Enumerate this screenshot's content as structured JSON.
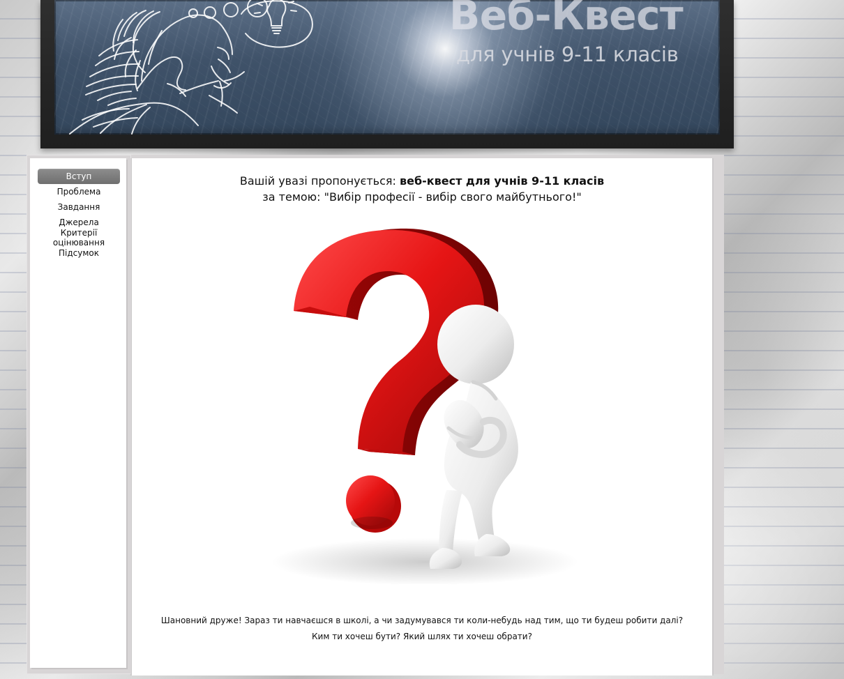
{
  "header": {
    "title": "Веб-Квест",
    "subtitle": "для учнів 9-11 класів"
  },
  "sidebar": {
    "items": [
      {
        "label": "Вступ",
        "active": true
      },
      {
        "label": "Проблема",
        "active": false
      },
      {
        "label": "Завдання",
        "active": false
      },
      {
        "label": "Джерела",
        "active": false
      },
      {
        "label": "Критерії оцінювання",
        "active": false
      },
      {
        "label": "Підсумок",
        "active": false
      }
    ]
  },
  "main": {
    "intro_prefix": "Вашій увазі пропонується: ",
    "intro_bold": "веб-квест для учнів 9-11 класів",
    "topic_line": "за темою: \"Вибір професії - вибір свого майбутнього!\"",
    "paragraph_1": "Шановний друже! Зараз ти навчаєшся в школі, а чи задумувався ти коли-небудь над тим, що ти будеш робити далі?",
    "paragraph_2": "Ким ти хочеш бути? Який шлях ти хочеш обрати?"
  },
  "colors": {
    "active_menu": "#7d7d7d",
    "question_red": "#e01616",
    "board_blue": "#44576e"
  },
  "icons": {
    "header_illustration": "thinking-woman-sketch",
    "hero_illustration": "question-mark-figure"
  }
}
